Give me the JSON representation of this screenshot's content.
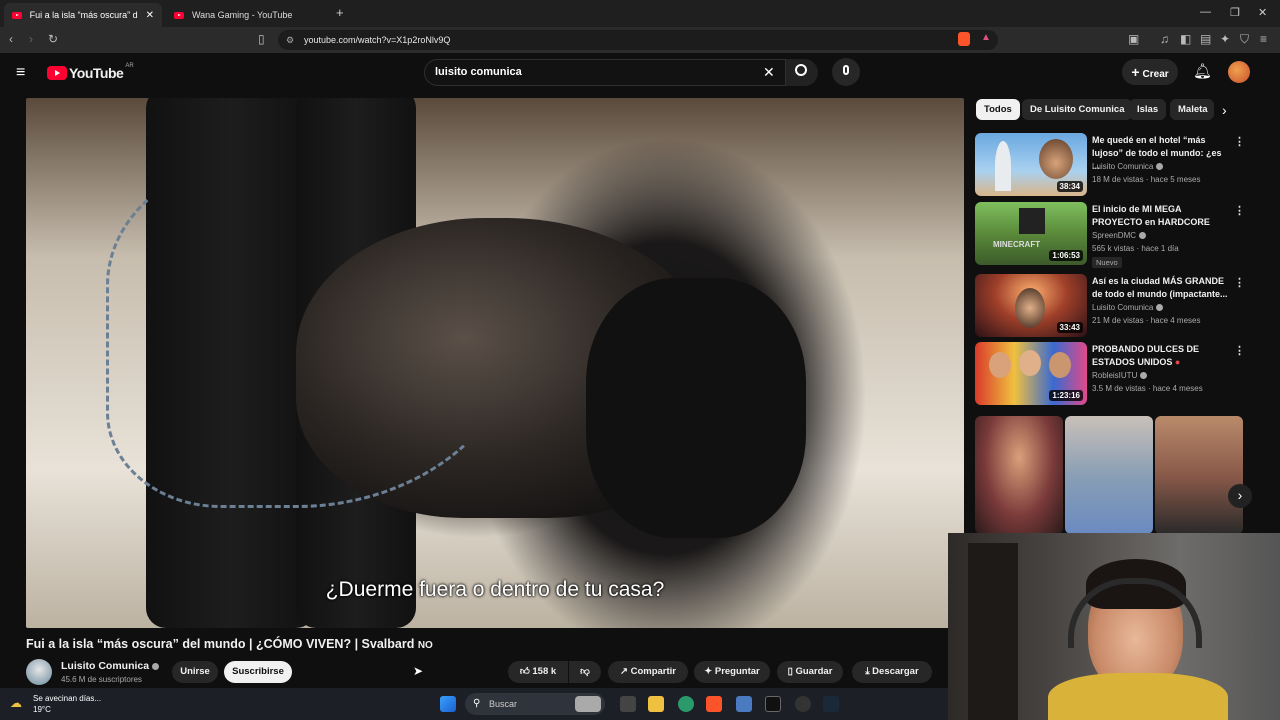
{
  "browser": {
    "tabs": [
      {
        "label": "Fui a la isla “más oscura” del",
        "active": true
      },
      {
        "label": "Wana Gaming - YouTube",
        "active": false
      }
    ],
    "url": "youtube.com/watch?v=X1p2roNlv9Q"
  },
  "header": {
    "logo_text": "YouTube",
    "region": "AR",
    "search_value": "luisito comunica",
    "create_label": "Crear"
  },
  "video": {
    "subtitle": "¿Duerme fuera o dentro de tu casa?",
    "title": "Fui a la isla “más oscura” del mundo | ¿CÓMO VIVEN? | Svalbard",
    "title_suffix": "NO",
    "channel": "Luisito Comunica",
    "subscribers": "45.6 M de suscriptores",
    "join_label": "Unirse",
    "subscribe_label": "Suscribirse",
    "likes": "158 k",
    "share_label": "Compartir",
    "ask_label": "Preguntar",
    "save_label": "Guardar",
    "download_label": "Descargar"
  },
  "chips": [
    "Todos",
    "De Luisito Comunica",
    "Islas",
    "Maleta"
  ],
  "recommendations": [
    {
      "title": "Me quedé en el hotel “más lujoso” de todo el mundo: ¿es ...",
      "channel": "Luisito Comunica",
      "meta": "18 M de vistas · hace 5 meses",
      "duration": "38:34",
      "badge": ""
    },
    {
      "title": "El inicio de MI MEGA PROYECTO en HARDCORE",
      "channel": "SpreenDMC",
      "meta": "565 k vistas · hace 1 día",
      "duration": "1:06:53",
      "badge": "Nuevo"
    },
    {
      "title": "Así es la ciudad MÁS GRANDE de todo el mundo (impactante...",
      "channel": "Luisito Comunica",
      "meta": "21 M de vistas · hace 4 meses",
      "duration": "33:43",
      "badge": ""
    },
    {
      "title": "PROBANDO DULCES DE ESTADOS UNIDOS",
      "channel": "RobleisIUTU",
      "meta": "3.5 M de vistas · hace 4 meses",
      "duration": "1:23:16",
      "badge": ""
    }
  ],
  "taskbar": {
    "weather_text": "Se avecinan días...",
    "temperature": "19°C",
    "search_placeholder": "Buscar"
  },
  "colors": {
    "accent": "#ff0033",
    "background": "#0f0f0f",
    "chip": "#272727"
  }
}
